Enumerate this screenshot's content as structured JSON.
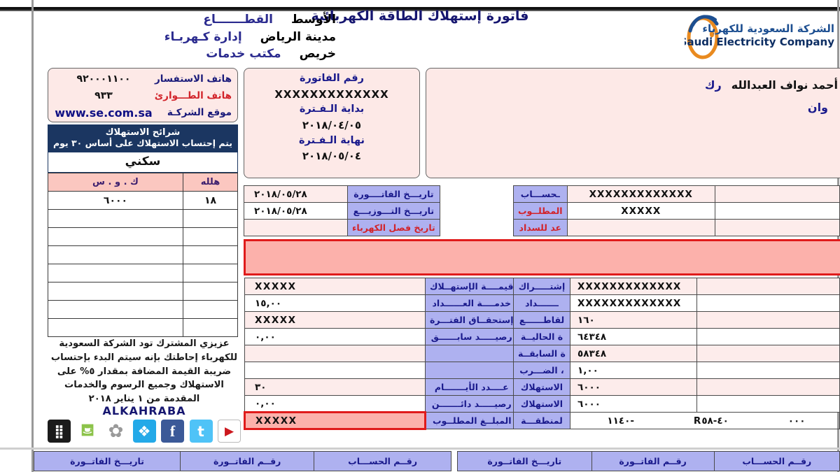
{
  "header": {
    "bill_title": "فاتورة إستهلاك الطاقة الكهربائية",
    "sector_rows": [
      {
        "label": "القطـــــــاع",
        "value": "الأوسط"
      },
      {
        "label": "إدارة كـهربـاء",
        "value": "مدينة الرياض"
      },
      {
        "label": "مكتب خدمات",
        "value": "خريص"
      }
    ],
    "logo": {
      "arabic": "الشركة السعودية للكهرباء",
      "english": "Saudi Electricity Company",
      "mark_name": "sec-oval-logo",
      "color_blue": "#1d4f91",
      "color_orange": "#e98a1f"
    }
  },
  "contact": {
    "rows": [
      {
        "label": "هاتف الاستفسار",
        "value": "٩٢٠٠٠١١٠٠"
      },
      {
        "label": "هاتف الطـــوارئ",
        "value": "٩٣٣"
      },
      {
        "label": "موقع الشركـة",
        "value": "www.se.com.sa"
      }
    ]
  },
  "slices": {
    "title_line1": "شرائح الاستهلاك",
    "title_line2": "يتم إحتساب الاستهلاك على أساس ٣٠ يوم",
    "type": "سكني",
    "columns": [
      "هلله",
      "ك . و . س"
    ],
    "rows": [
      {
        "halala": "١٨",
        "kwh": "٦٠٠٠"
      },
      {
        "halala": "",
        "kwh": ""
      },
      {
        "halala": "",
        "kwh": ""
      },
      {
        "halala": "",
        "kwh": ""
      },
      {
        "halala": "",
        "kwh": ""
      },
      {
        "halala": "",
        "kwh": ""
      },
      {
        "halala": "",
        "kwh": ""
      },
      {
        "halala": "",
        "kwh": ""
      }
    ]
  },
  "notice": {
    "text": "عزيزي المشترك تود الشركة السعودية للكهرباء إحاطتك بإنه سيتم البدء بإحتساب ضريبة القيمة المضافة بمقدار ٥% على الاستهلاك وجميع الرسوم والخدمات المقدمة من ١ يناير ٢٠١٨"
  },
  "app": {
    "brand": "ALKAHRABA",
    "social_icons": [
      {
        "name": "blackberry-icon",
        "glyph": "▰",
        "bg": "#1b1b1b",
        "fg": "#ffffff"
      },
      {
        "name": "android-icon",
        "glyph": "🤖",
        "bg": "#ffffff",
        "fg": "#8cc34a"
      },
      {
        "name": "apple-icon",
        "glyph": "",
        "bg": "#ffffff",
        "fg": "#9a9a9a"
      },
      {
        "name": "windows-icon",
        "glyph": "❒",
        "bg": "#23a9e8",
        "fg": "#ffffff"
      },
      {
        "name": "facebook-icon",
        "glyph": "f",
        "bg": "#3b5998",
        "fg": "#ffffff"
      },
      {
        "name": "twitter-icon",
        "glyph": "t",
        "bg": "#4fc3f7",
        "fg": "#ffffff"
      },
      {
        "name": "youtube-icon",
        "glyph": "▶",
        "bg": "#ffffff",
        "fg": "#cc181e"
      }
    ]
  },
  "invoice_box": {
    "invoice_no_label": "رقم الفاتورة",
    "invoice_no_value": "XXXXXXXXXXXXX",
    "period_start_label": "بداية الـفـترة",
    "period_start_value": "٢٠١٨/٠٤/٠٥",
    "period_end_label": "نهاية الـفـترة",
    "period_end_value": "٢٠١٨/٠٥/٠٤"
  },
  "customer": {
    "name_label": "رك",
    "name_value": "أحمد نواف العبدالله",
    "address_label": "وان",
    "address_value": ""
  },
  "mid_top_rows": [
    {
      "label": "تاريـــخ الفاتــــورة",
      "value": "٢٠١٨/٠٥/٢٨",
      "red": false
    },
    {
      "label": "تاريـــخ التـــوزيـــع",
      "value": "٢٠١٨/٠٥/٢٨",
      "red": false
    },
    {
      "label": "تاريخ فصل الكهرباء",
      "value": "",
      "red": true
    }
  ],
  "right_top_rows": [
    {
      "label": "ـحســـاب",
      "value": "XXXXXXXXXXXXX",
      "red": false
    },
    {
      "label": "المطلــوب",
      "value": "XXXXX",
      "red": true
    },
    {
      "label": "عد للسداد",
      "value": "",
      "red": true
    }
  ],
  "mid_main_rows": [
    {
      "label": "قيمــــة الإستهــلاك",
      "value": "XXXXX"
    },
    {
      "label": "خدمــــة العــــــداد",
      "value": "١٥,٠٠"
    },
    {
      "label": "إستحقــاق الفتـــرة",
      "value": "XXXXX"
    },
    {
      "label": "رصيـــــد سابــــــق",
      "value": "٠,٠٠"
    },
    {
      "label": "",
      "value": ""
    },
    {
      "label": "",
      "value": ""
    },
    {
      "label": "عــــدد الأيـــــــام",
      "value": "٣٠"
    },
    {
      "label": "رصيـــــد دائـــــــن",
      "value": "٠,٠٠"
    },
    {
      "label": "المبلــغ المطلــوب",
      "value": "XXXXX"
    }
  ],
  "right_main_rows": [
    {
      "label": "إشتـــــراك",
      "value": "XXXXXXXXXXXXX"
    },
    {
      "label": "ـــــــداد",
      "value": "XXXXXXXXXXXXX"
    },
    {
      "label": "لقاطــــــع",
      "value": "١٦٠"
    },
    {
      "label": "ة الحاليــة",
      "value": "٦٤٣٤٨"
    },
    {
      "label": "ة السابقــة",
      "value": "٥٨٣٤٨"
    },
    {
      "label": "، الضـــرب",
      "value": "١,٠٠"
    },
    {
      "label": "الاستهلاك",
      "value": "٦٠٠٠"
    },
    {
      "label": "الاستهلاك",
      "value": "٦٠٠٠"
    },
    {
      "label": "لمنطقـــة",
      "value": [
        "١١٤٠-",
        "R٤٠-٥٨",
        "٠٠٠"
      ]
    }
  ],
  "stub_headers": [
    "رقــم الحســـاب",
    "رقــم الفاتــورة",
    "تاريـــخ الفاتــورة"
  ]
}
